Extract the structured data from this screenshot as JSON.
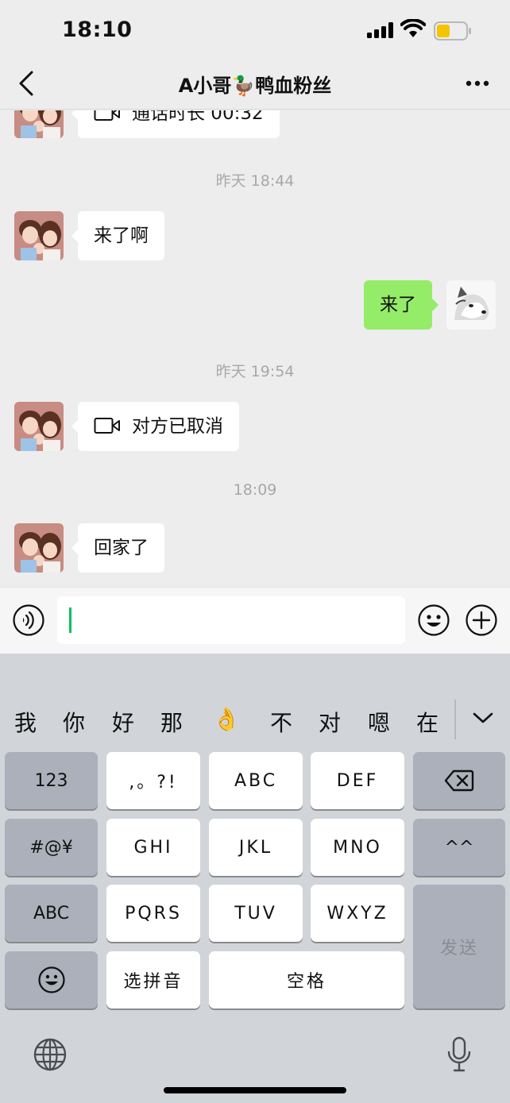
{
  "status": {
    "time": "18:10"
  },
  "nav": {
    "title": "A小哥🦆鸭血粉丝"
  },
  "messages": [
    {
      "side": "in",
      "text": "通话时长 00:32"
    },
    {
      "timestamp": "昨天 18:44"
    },
    {
      "side": "in",
      "text": "来了啊"
    },
    {
      "side": "out",
      "text": "来了"
    },
    {
      "timestamp": "昨天 19:54"
    },
    {
      "side": "in",
      "text": "对方已取消"
    },
    {
      "timestamp": "18:09"
    },
    {
      "side": "in",
      "text": "回家了"
    }
  ],
  "input": {
    "value": ""
  },
  "keyboard": {
    "candidates": [
      "我",
      "你",
      "好",
      "那",
      "👌",
      "不",
      "对",
      "嗯",
      "在"
    ],
    "keys": {
      "num": "123",
      "punct": ",。?!",
      "abc": "ABC",
      "def": "DEF",
      "sym": "#@¥",
      "ghi": "GHI",
      "jkl": "JKL",
      "mno": "MNO",
      "kaomoji": "^^",
      "abc_mode": "ABC",
      "pqrs": "PQRS",
      "tuv": "TUV",
      "wxyz": "WXYZ",
      "send": "发送",
      "pinyin": "选拼音",
      "space": "空格"
    }
  },
  "colors": {
    "accent": "#07c160",
    "out_bubble": "#95ec69",
    "bg": "#ededed"
  }
}
